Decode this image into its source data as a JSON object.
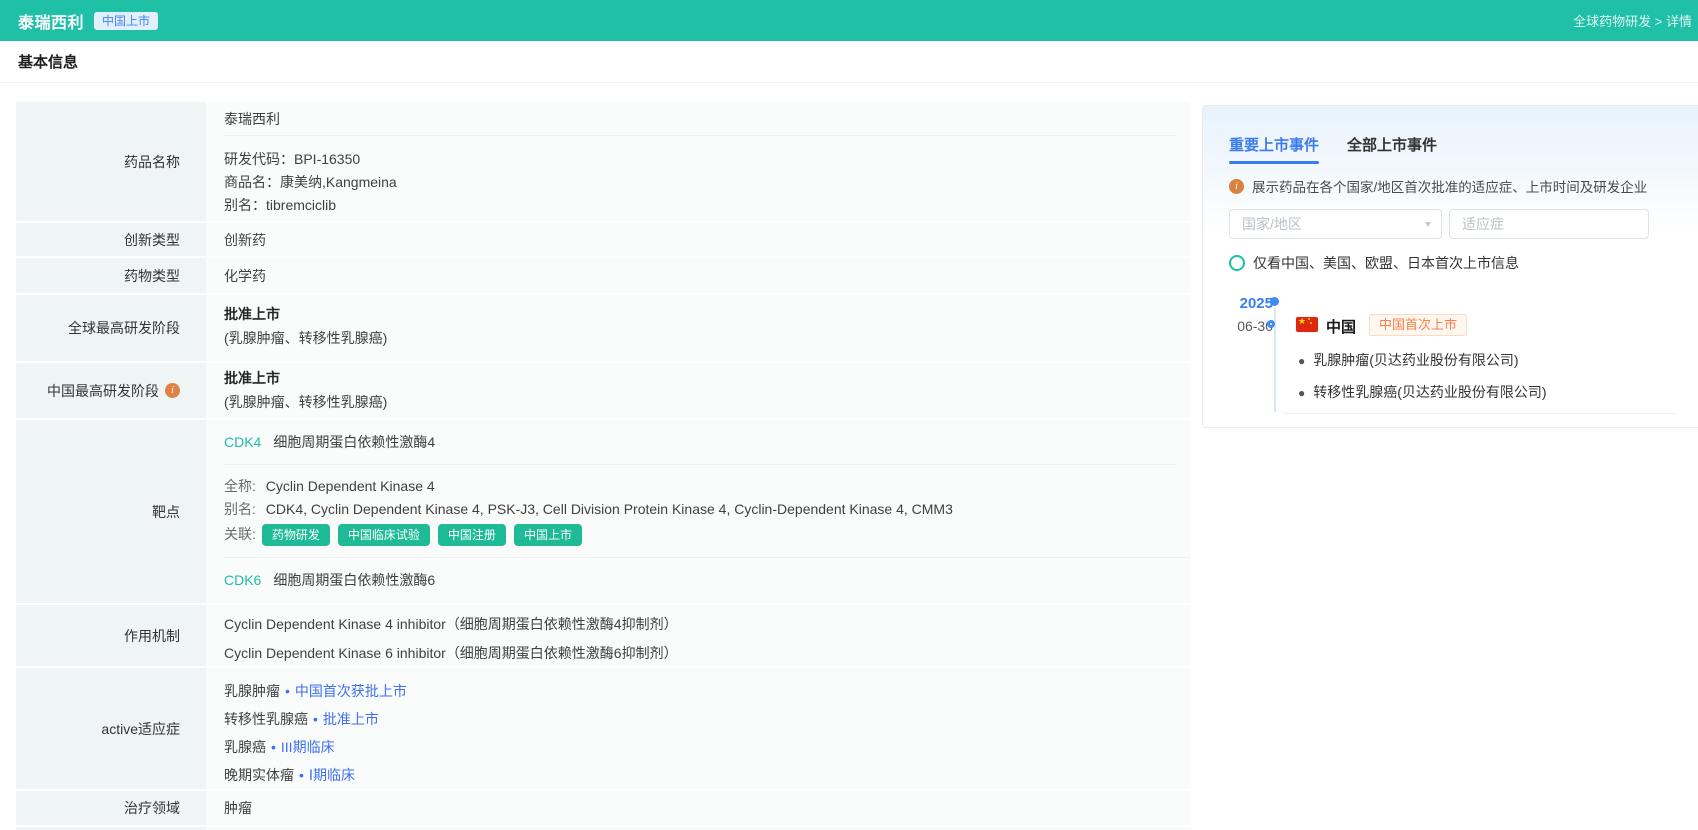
{
  "colors": {
    "accent_teal": "#20c0a7",
    "tag_teal": "#1fbb97",
    "tab_blue": "#3a7cf0",
    "link_blue": "#3f6ff2",
    "info_orange": "#df8244",
    "badge_orange": "#ff7e45"
  },
  "header": {
    "title": "泰瑞西利",
    "badge": "中国上市",
    "breadcrumb": "全球药物研发 > 详情"
  },
  "section_title": "基本信息",
  "info_table": {
    "drug_name": {
      "label": "药品名称",
      "primary": "泰瑞西利",
      "lines": [
        "研发代码：BPI-16350",
        "商品名：康美纳,Kangmeina",
        "别名：tibremciclib"
      ]
    },
    "innovation_type": {
      "label": "创新类型",
      "value": "创新药"
    },
    "drug_type": {
      "label": "药物类型",
      "value": "化学药"
    },
    "global_stage": {
      "label": "全球最高研发阶段",
      "stage": "批准上市",
      "detail": "(乳腺肿瘤、转移性乳腺癌)"
    },
    "china_stage": {
      "label": "中国最高研发阶段",
      "stage": "批准上市",
      "detail": "(乳腺肿瘤、转移性乳腺癌)"
    },
    "targets": {
      "label": "靶点",
      "target1": {
        "code": "CDK4",
        "name": "细胞周期蛋白依赖性激酶4",
        "full_label": "全称:",
        "full_name": "Cyclin Dependent Kinase 4",
        "alias_label": "别名:",
        "alias": "CDK4, Cyclin Dependent Kinase 4, PSK-J3, Cell Division Protein Kinase 4, Cyclin-Dependent Kinase 4, CMM3",
        "relation_label": "关联:",
        "tags": [
          "药物研发",
          "中国临床试验",
          "中国注册",
          "中国上市"
        ]
      },
      "target2": {
        "code": "CDK6",
        "name": "细胞周期蛋白依赖性激酶6"
      }
    },
    "mechanism": {
      "label": "作用机制",
      "lines": [
        "Cyclin Dependent Kinase 4 inhibitor（细胞周期蛋白依赖性激酶4抑制剂）",
        "Cyclin Dependent Kinase 6 inhibitor（细胞周期蛋白依赖性激酶6抑制剂）"
      ]
    },
    "active_indications": {
      "label": "active适应症",
      "items": [
        {
          "name": "乳腺肿瘤",
          "status": "中国首次获批上市"
        },
        {
          "name": "转移性乳腺癌",
          "status": "批准上市"
        },
        {
          "name": "乳腺癌",
          "status": "III期临床"
        },
        {
          "name": "晚期实体瘤",
          "status": "Ⅰ期临床"
        }
      ]
    },
    "therapy_area": {
      "label": "治疗领域",
      "value": "肿瘤"
    }
  },
  "events_panel": {
    "tabs": [
      {
        "label": "重要上市事件"
      },
      {
        "label": "全部上市事件"
      }
    ],
    "hint": "展示药品在各个国家/地区首次批准的适应症、上市时间及研发企业",
    "filters": {
      "country_placeholder": "国家/地区",
      "indication_placeholder": "适应症"
    },
    "radio_label": "仅看中国、美国、欧盟、日本首次上市信息",
    "timeline": {
      "year": "2025",
      "date": "06-30",
      "country": "中国",
      "event_badge": "中国首次上市",
      "items": [
        "乳腺肿瘤(贝达药业股份有限公司)",
        "转移性乳腺癌(贝达药业股份有限公司)"
      ]
    }
  }
}
